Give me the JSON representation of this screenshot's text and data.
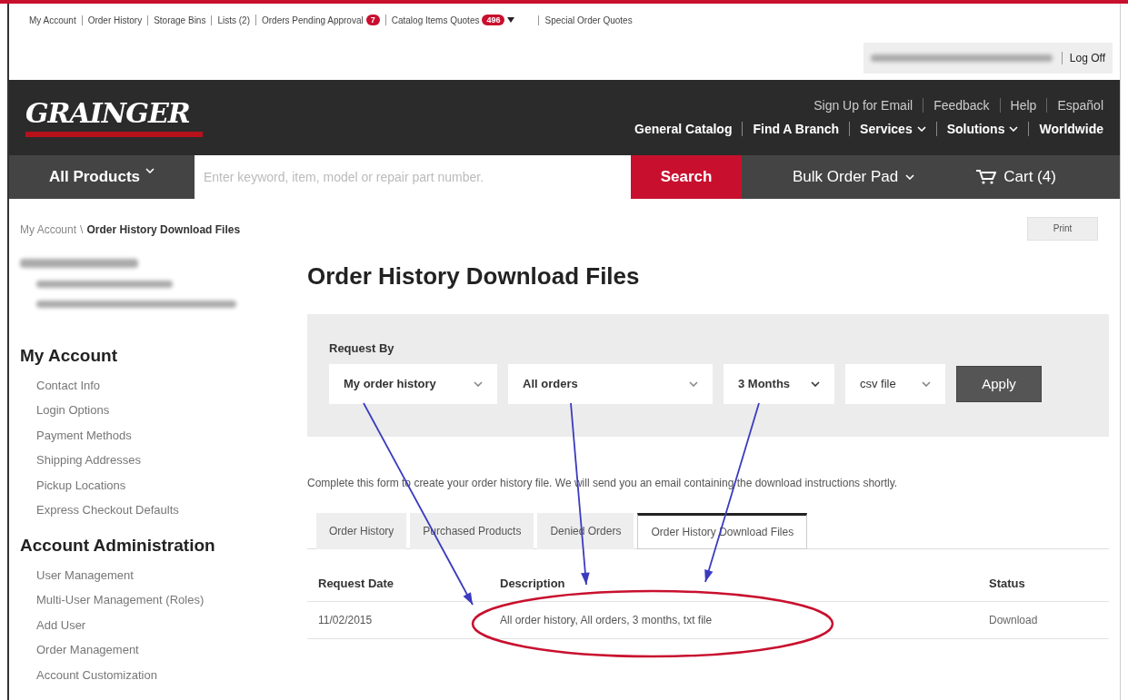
{
  "top_links": [
    {
      "label": "My Account"
    },
    {
      "label": "Order History"
    },
    {
      "label": "Storage Bins"
    },
    {
      "label": "Lists (2)"
    },
    {
      "label": "Orders Pending Approval",
      "badge": "7",
      "dropdown": false
    },
    {
      "label": "Catalog Items Quotes",
      "badge": "496",
      "dropdown": true
    },
    {
      "label": "Special Order Quotes"
    }
  ],
  "account_bar": {
    "log_off": "Log Off"
  },
  "header": {
    "logo": "GRAINGER",
    "utility_links": [
      "Sign Up for Email",
      "Feedback",
      "Help",
      "Español"
    ],
    "nav_links": [
      {
        "label": "General Catalog",
        "dropdown": false
      },
      {
        "label": "Find A Branch",
        "dropdown": false
      },
      {
        "label": "Services",
        "dropdown": true
      },
      {
        "label": "Solutions",
        "dropdown": true
      },
      {
        "label": "Worldwide",
        "dropdown": false
      }
    ]
  },
  "nav_bar": {
    "all_products": "All Products",
    "search_placeholder": "Enter keyword, item, model or repair part number.",
    "search_button": "Search",
    "bulk_order": "Bulk Order Pad",
    "cart": "Cart (4)"
  },
  "breadcrumb": {
    "items": [
      "My Account",
      "Order History Download Files"
    ],
    "separator": "\\"
  },
  "print_button": "Print",
  "sidebar": {
    "sections": [
      {
        "title": "My Account",
        "items": [
          "Contact Info",
          "Login Options",
          "Payment Methods",
          "Shipping Addresses",
          "Pickup Locations",
          "Express Checkout Defaults"
        ]
      },
      {
        "title": "Account Administration",
        "items": [
          "User Management",
          "Multi-User Management (Roles)",
          "Add User",
          "Order Management",
          "Account Customization"
        ]
      }
    ]
  },
  "main": {
    "title": "Order History Download Files",
    "request_by": "Request By",
    "selects": [
      {
        "value": "My order history"
      },
      {
        "value": "All orders"
      },
      {
        "value": "3 Months"
      },
      {
        "value": "csv file"
      }
    ],
    "apply": "Apply",
    "note": "Complete this form to create your order history file. We will send you an email containing the download instructions shortly.",
    "tabs": [
      {
        "label": "Order History",
        "selected": false
      },
      {
        "label": "Purchased Products",
        "selected": false
      },
      {
        "label": "Denied Orders",
        "selected": false
      },
      {
        "label": "Order History Download Files",
        "selected": true
      }
    ],
    "table": {
      "columns": [
        "Request Date",
        "Description",
        "Status"
      ],
      "rows": [
        {
          "date": "11/02/2015",
          "description": "All order history, All orders, 3 months, txt file",
          "status": "Download"
        }
      ]
    }
  }
}
